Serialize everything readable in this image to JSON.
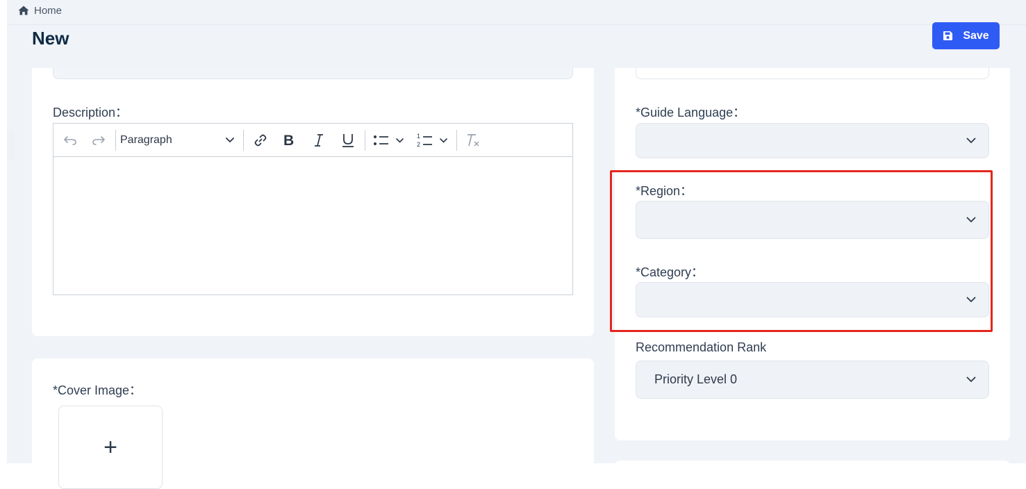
{
  "breadcrumb": {
    "home_label": "Home"
  },
  "page": {
    "title": "New"
  },
  "toolbar": {
    "save_label": "Save"
  },
  "description": {
    "label": "Description：",
    "editor": {
      "paragraph_select": "Paragraph",
      "tools": [
        "undo-icon",
        "redo-icon",
        "link-icon",
        "bold-icon",
        "italic-icon",
        "underline-icon",
        "bulleted-list-icon",
        "numbered-list-icon",
        "remove-format-icon"
      ],
      "content": ""
    }
  },
  "cover_image": {
    "label": "*Cover Image：",
    "upload_glyph": "+"
  },
  "guide_language": {
    "label": "*Guide Language：",
    "value": ""
  },
  "region": {
    "label": "*Region：",
    "value": ""
  },
  "category": {
    "label": "*Category：",
    "value": ""
  },
  "recommendation_rank": {
    "label": "Recommendation Rank",
    "value": "Priority Level 0"
  },
  "colors": {
    "primary": "#2f5bf5",
    "highlight": "#e3261f",
    "page_bg": "#f0f3f7",
    "title": "#0f2a44"
  }
}
